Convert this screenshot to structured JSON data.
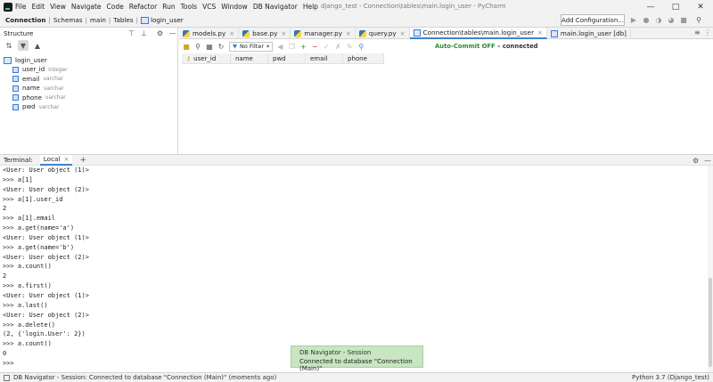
{
  "menu": [
    "File",
    "Edit",
    "View",
    "Navigate",
    "Code",
    "Refactor",
    "Run",
    "Tools",
    "VCS",
    "Window",
    "DB Navigator",
    "Help"
  ],
  "window_title": "django_test - Connection\\tables\\main.login_user - PyCharm",
  "breadcrumbs": [
    "Connection",
    "Schemas",
    "main",
    "Tables",
    "login_user"
  ],
  "add_config": "Add Configuration...",
  "structure": {
    "title": "Structure",
    "root": "login_user",
    "columns": [
      {
        "name": "user_id",
        "type": "integer"
      },
      {
        "name": "email",
        "type": "varchar"
      },
      {
        "name": "name",
        "type": "varchar"
      },
      {
        "name": "phone",
        "type": "varchar"
      },
      {
        "name": "pwd",
        "type": "varchar"
      }
    ]
  },
  "editor_tabs": [
    {
      "label": "models.py",
      "kind": "py"
    },
    {
      "label": "base.py",
      "kind": "py"
    },
    {
      "label": "manager.py",
      "kind": "py"
    },
    {
      "label": "query.py",
      "kind": "py"
    },
    {
      "label": "Connection\\tables\\main.login_user",
      "kind": "db"
    },
    {
      "label": "main.login_user [db]",
      "kind": "db"
    }
  ],
  "grid_toolbar": {
    "filter": "No Filter",
    "autocommit": "Auto-Commit OFF",
    "connected": "connected"
  },
  "grid_columns": [
    "user_id",
    "name",
    "pwd",
    "email",
    "phone"
  ],
  "terminal": {
    "label": "Terminal:",
    "tab": "Local",
    "lines": [
      "<User: User object (1)>",
      ">>> a[1]",
      "<User: User object (2)>",
      ">>> a[1].user_id",
      "2",
      ">>> a[1].email",
      ">>> a.get(name='a')",
      "<User: User object (1)>",
      ">>> a.get(name='b')",
      "<User: User object (2)>",
      ">>> a.count()",
      "2",
      ">>> a.first()",
      "<User: User object (1)>",
      ">>> a.last()",
      "<User: User object (2)>",
      ">>> a.delete()",
      "(2, {'login.User': 2})",
      ">>> a.count()",
      "0",
      ">>>"
    ]
  },
  "notification": {
    "title": "DB Navigator - Session",
    "message": "Connected to database \"Connection (Main)\""
  },
  "statusbar": {
    "text": "DB Navigator - Session: Connected to database \"Connection (Main)\" (moments ago)",
    "interpreter": "Python 3.7 (Django_test)"
  },
  "colors": {
    "accent": "#4083c9",
    "autocommit": "#2d8a34",
    "notification_bg": "#c8e6c1"
  }
}
